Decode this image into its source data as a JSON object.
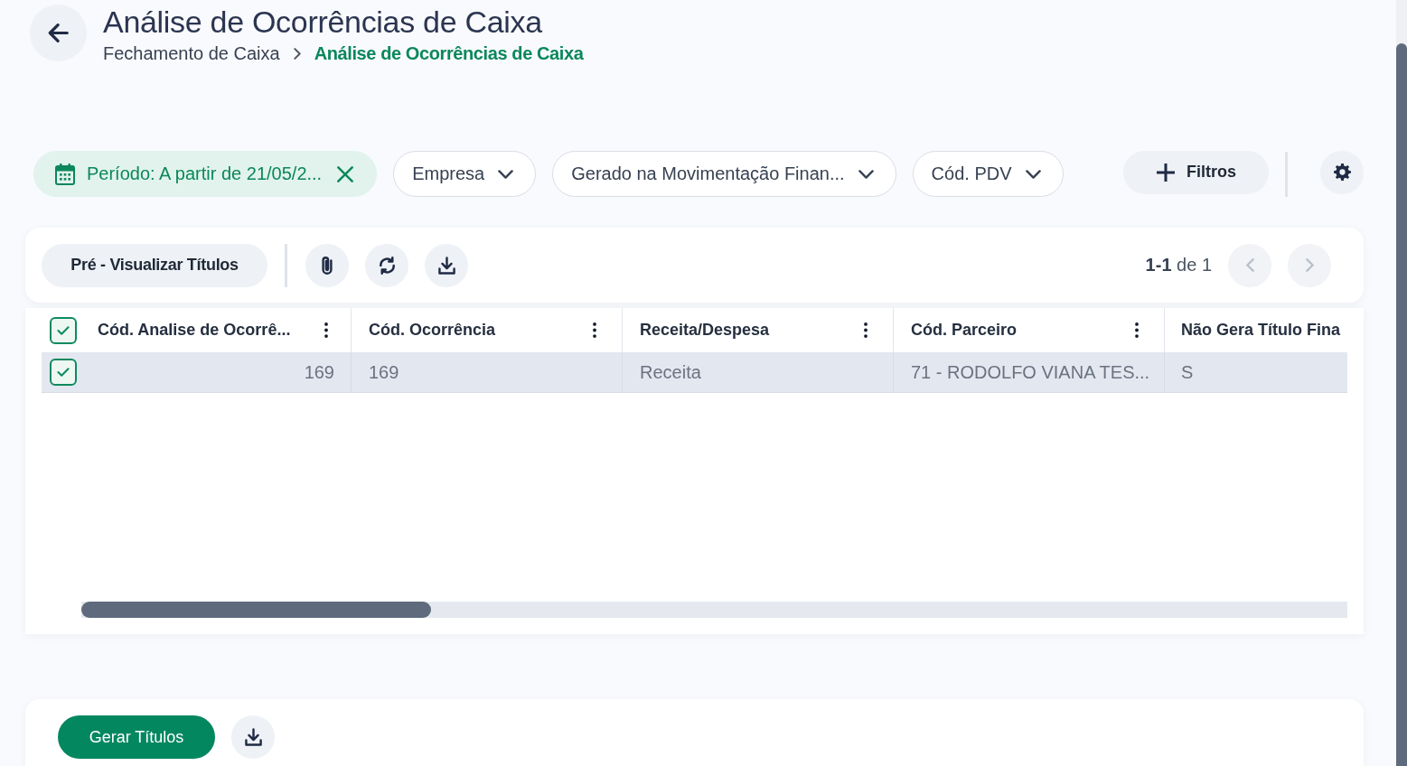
{
  "header": {
    "title": "Análise de Ocorrências de Caixa",
    "breadcrumb": [
      {
        "label": "Fechamento de Caixa",
        "current": false
      },
      {
        "label": "Análise de Ocorrências de Caixa",
        "current": true
      }
    ]
  },
  "filters": [
    {
      "kind": "date",
      "label": "Período: A partir de 21/05/2...",
      "applied": true
    },
    {
      "kind": "dropdown",
      "label": "Empresa",
      "applied": false
    },
    {
      "kind": "dropdown",
      "label": "Gerado na Movimentação Finan...",
      "applied": false
    },
    {
      "kind": "dropdown",
      "label": "Cód. PDV",
      "applied": false
    }
  ],
  "filters_button": {
    "label": "Filtros"
  },
  "toolbar": {
    "preview_button": {
      "label": "Pré - Visualizar Títulos"
    },
    "pagination": {
      "range": "**1-1** de 1",
      "prev_disabled": true,
      "next_disabled": true
    }
  },
  "table": {
    "all_checked": true,
    "columns": [
      {
        "label": "Cód. Analise de Ocorrê...",
        "kind": "number",
        "menu": true
      },
      {
        "label": "Cód. Ocorrência",
        "kind": "text",
        "menu": true
      },
      {
        "label": "Receita/Despesa",
        "kind": "text",
        "menu": true
      },
      {
        "label": "Cód. Parceiro",
        "kind": "text",
        "menu": true
      },
      {
        "label": "Não Gera Título Fina",
        "kind": "text",
        "menu": false
      }
    ],
    "rows": [
      {
        "checked": true,
        "selected": true,
        "cells": [
          "169",
          "169",
          "Receita",
          "71 - RODOLFO VIANA TES...",
          "S"
        ]
      }
    ]
  },
  "footer": {
    "primary_button": {
      "label": "Gerar Títulos"
    }
  }
}
